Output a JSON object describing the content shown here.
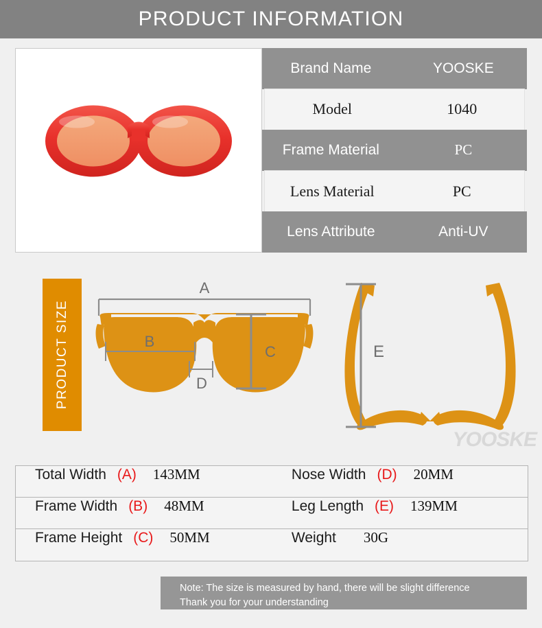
{
  "header": {
    "title": "PRODUCT INFORMATION"
  },
  "product_photo": {
    "alt": "red oval sunglasses with orange tinted lenses",
    "frame_color": "#e8312b",
    "lens_color": "#f2a071"
  },
  "spec_table": {
    "rows": [
      {
        "label": "Brand Name",
        "value": "YOOSKE",
        "style": "gray"
      },
      {
        "label": "Model",
        "value": "1040",
        "style": "light"
      },
      {
        "label": "Frame Material",
        "value": "PC",
        "style": "gray"
      },
      {
        "label": "Lens Material",
        "value": "PC",
        "style": "light"
      },
      {
        "label": "Lens Attribute",
        "value": "Anti-UV",
        "style": "gray"
      }
    ]
  },
  "size_section": {
    "side_label": "PRODUCT SIZE",
    "watermark": "YOOSKE",
    "markers": {
      "a": "A",
      "b": "B",
      "c": "C",
      "d": "D",
      "e": "E"
    },
    "diagram_color": "#dd9215",
    "measure_line_color": "#8c8c8c"
  },
  "dimension_table": {
    "rows": [
      {
        "left": {
          "name": "Total Width",
          "letter": "(A)",
          "value": "143MM"
        },
        "right": {
          "name": "Nose Width",
          "letter": "(D)",
          "value": "20MM"
        }
      },
      {
        "left": {
          "name": "Frame Width",
          "letter": "(B)",
          "value": "48MM"
        },
        "right": {
          "name": "Leg Length",
          "letter": "(E)",
          "value": "139MM"
        }
      },
      {
        "left": {
          "name": "Frame Height",
          "letter": "(C)",
          "value": "50MM"
        },
        "right": {
          "name": "Weight",
          "letter": "",
          "value": "30G"
        }
      }
    ],
    "letter_color": "#e8191a"
  },
  "note": {
    "line1": "Note: The size is measured by hand, there will be slight difference",
    "line2": "Thank you for your understanding"
  }
}
